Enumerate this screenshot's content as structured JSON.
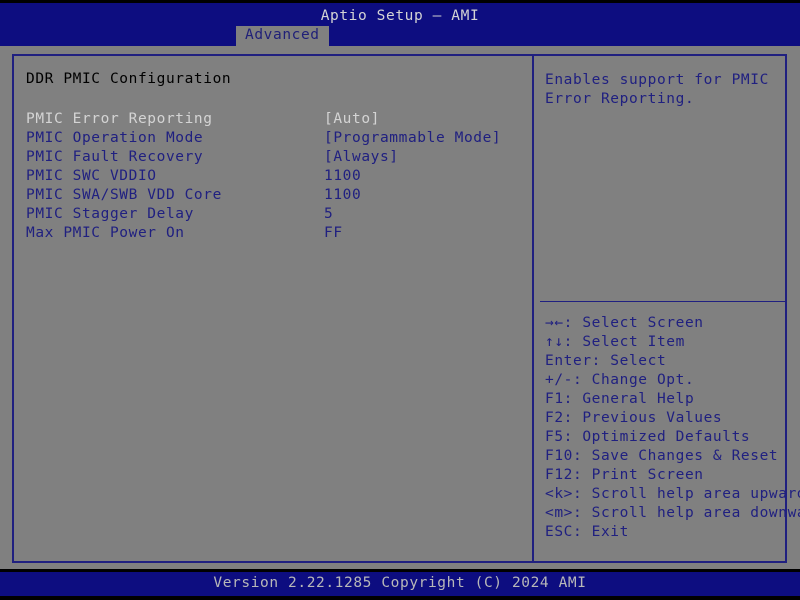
{
  "header": {
    "title": "Aptio Setup – AMI",
    "tabs": [
      {
        "label": "Advanced",
        "active": true
      }
    ]
  },
  "main": {
    "section_title": "DDR PMIC Configuration",
    "settings": [
      {
        "label": "PMIC Error Reporting",
        "value": "[Auto]",
        "selected": true
      },
      {
        "label": "PMIC Operation Mode",
        "value": "[Programmable Mode]",
        "selected": false
      },
      {
        "label": "PMIC Fault Recovery",
        "value": "[Always]",
        "selected": false
      },
      {
        "label": "PMIC SWC VDDIO",
        "value": "1100",
        "selected": false
      },
      {
        "label": "PMIC SWA/SWB VDD Core",
        "value": "1100",
        "selected": false
      },
      {
        "label": "PMIC Stagger Delay",
        "value": "5",
        "selected": false
      },
      {
        "label": "Max PMIC Power On",
        "value": "FF",
        "selected": false
      }
    ]
  },
  "help": {
    "text": "Enables support for PMIC Error Reporting.",
    "keys": [
      "→←: Select Screen",
      "↑↓: Select Item",
      "Enter: Select",
      "+/-: Change Opt.",
      "F1: General Help",
      "F2: Previous Values",
      "F5: Optimized Defaults",
      "F10: Save Changes & Reset",
      "F12: Print Screen",
      "<k>: Scroll help area upwards",
      "<m>: Scroll help area downwards",
      "ESC: Exit"
    ]
  },
  "footer": {
    "version_text": "Version 2.22.1285 Copyright (C) 2024 AMI"
  },
  "colors": {
    "background_gray": "#808080",
    "header_blue": "#0d0d80",
    "text_blue": "#202080",
    "text_light": "#d4d4d4",
    "text_black": "#000000",
    "footer_text": "#b8b8b8"
  }
}
